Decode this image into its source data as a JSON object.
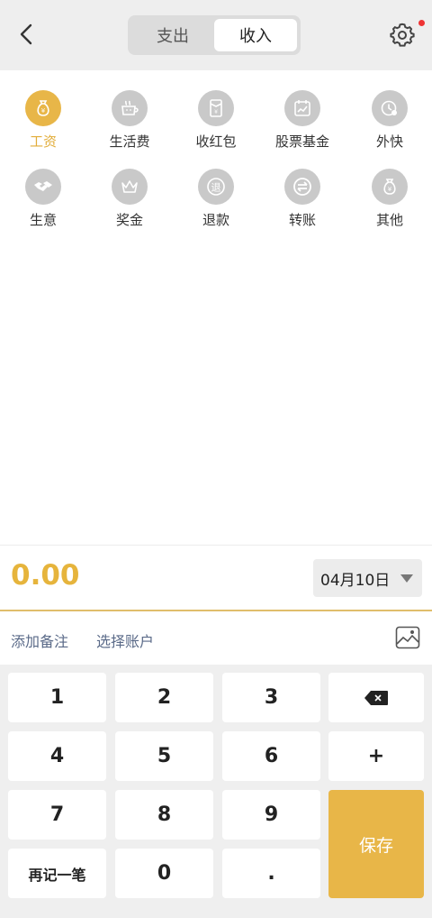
{
  "header": {
    "back_icon": "chevron-left-icon",
    "tabs": [
      {
        "label": "支出",
        "active": false
      },
      {
        "label": "收入",
        "active": true
      }
    ],
    "settings_icon": "gear-icon",
    "has_notification_dot": true
  },
  "categories": [
    {
      "label": "工资",
      "icon": "money-bag-icon",
      "active": true
    },
    {
      "label": "生活费",
      "icon": "coffee-cup-icon",
      "active": false
    },
    {
      "label": "收红包",
      "icon": "red-envelope-icon",
      "active": false
    },
    {
      "label": "股票基金",
      "icon": "stock-chart-icon",
      "active": false
    },
    {
      "label": "外快",
      "icon": "clock-icon",
      "active": false
    },
    {
      "label": "生意",
      "icon": "handshake-icon",
      "active": false
    },
    {
      "label": "奖金",
      "icon": "crown-icon",
      "active": false
    },
    {
      "label": "退款",
      "icon": "refund-icon",
      "active": false,
      "glyph": "退"
    },
    {
      "label": "转账",
      "icon": "transfer-icon",
      "active": false
    },
    {
      "label": "其他",
      "icon": "other-icon",
      "active": false
    }
  ],
  "amount": "0.00",
  "date": "04月10日",
  "notes": {
    "add_note": "添加备注",
    "select_account": "选择账户"
  },
  "keypad": {
    "k1": "1",
    "k2": "2",
    "k3": "3",
    "k4": "4",
    "k5": "5",
    "k6": "6",
    "k7": "7",
    "k8": "8",
    "k9": "9",
    "k0": "0",
    "dot": ".",
    "plus": "+",
    "again": "再记一笔",
    "save": "保存"
  },
  "colors": {
    "accent": "#e8b648",
    "amount": "#e6b43c",
    "icon_inactive": "#c9c9c9",
    "link": "#5a6a88"
  }
}
